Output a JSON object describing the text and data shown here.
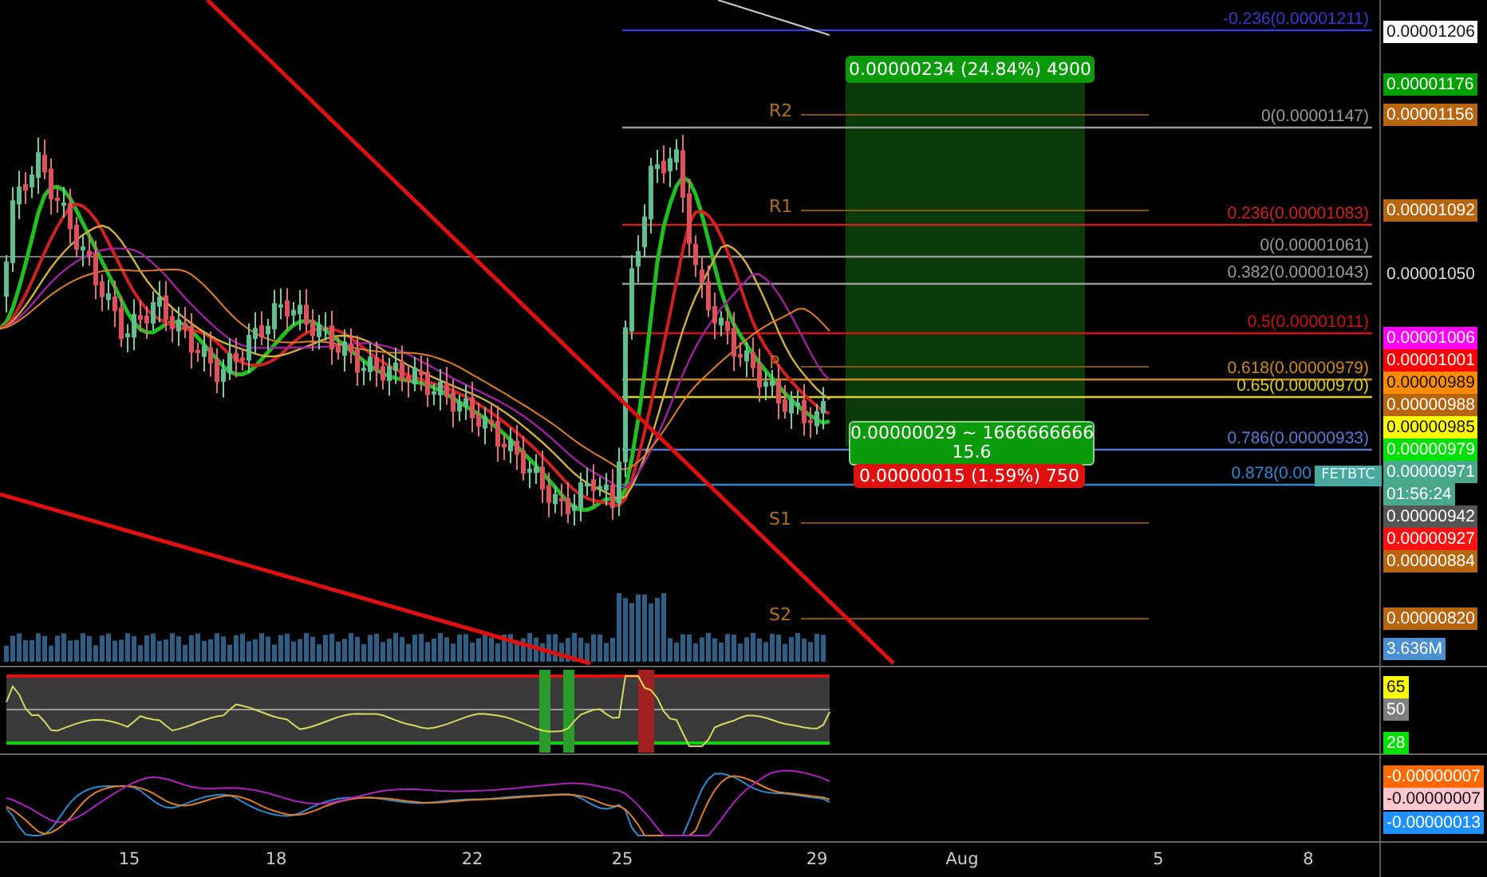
{
  "fib_levels": [
    {
      "label": "-0.236(0.00001211)",
      "color": "#3a3ad0"
    },
    {
      "label": "0(0.00001147)",
      "color": "#9a9a9a"
    },
    {
      "label": "0.236(0.00001083)",
      "color": "#d02020"
    },
    {
      "label": "0(0.00001061)",
      "color": "#9a9a9a"
    },
    {
      "label": "0.382(0.00001043)",
      "color": "#9a9a9a"
    },
    {
      "label": "0.5(0.00001011)",
      "color": "#d01010"
    },
    {
      "label": "0.618(0.00000979)",
      "color": "#d08a10"
    },
    {
      "label": "0.65(0.00000970)",
      "color": "#e0d010"
    },
    {
      "label": "0.786(0.00000933)",
      "color": "#5a7ad0"
    },
    {
      "label": "0.878(0.00",
      "color": "#2a8ad0"
    }
  ],
  "pivots": [
    {
      "label": "R2"
    },
    {
      "label": "R1"
    },
    {
      "label": "P"
    },
    {
      "label": "S1"
    },
    {
      "label": "S2"
    }
  ],
  "position_tool": {
    "target_label": "0.00000234 (24.84%) 4900",
    "ratio_lines": [
      "0.00000029 ~ 1666666666",
      "15.6"
    ],
    "stop_label": "0.00000015 (1.59%) 750"
  },
  "symbol_tag": "FETBTC",
  "price_axis": {
    "labels": [
      {
        "text": "0.00001206",
        "kind": "marker",
        "color": "#ffffff"
      },
      {
        "text": "0.00001176",
        "kind": "marker",
        "color": "#00a000"
      },
      {
        "text": "0.00001156",
        "kind": "marker",
        "color": "#b8650f"
      },
      {
        "text": "0.00001092",
        "kind": "marker",
        "color": "#b8650f"
      },
      {
        "text": "0.00001050",
        "kind": "grid"
      },
      {
        "text": "0.00001006",
        "kind": "marker",
        "color": "#ff00ff"
      },
      {
        "text": "0.00001001",
        "kind": "marker",
        "color": "#ff0000"
      },
      {
        "text": "0.00000989",
        "kind": "marker",
        "color": "#ff8c00"
      },
      {
        "text": "0.00000988",
        "kind": "marker",
        "color": "#b8650f"
      },
      {
        "text": "0.00000985",
        "kind": "marker",
        "color": "#ffff00"
      },
      {
        "text": "0.00000979",
        "kind": "marker",
        "color": "#00e000"
      },
      {
        "text": "0.00000971",
        "kind": "marker",
        "color": "#4aa88a"
      },
      {
        "text": "01:56:24",
        "kind": "marker",
        "color": "#4aa88a"
      },
      {
        "text": "0.00000942",
        "kind": "marker",
        "color": "#555555"
      },
      {
        "text": "0.00000927",
        "kind": "marker",
        "color": "#ff1010"
      },
      {
        "text": "0.00000884",
        "kind": "marker",
        "color": "#b8650f"
      },
      {
        "text": "0.00000820",
        "kind": "marker",
        "color": "#b8650f"
      }
    ]
  },
  "volume_axis": {
    "labels": [
      {
        "text": "3.636M",
        "color": "#4a90d0"
      }
    ]
  },
  "rsi_axis": {
    "labels": [
      {
        "text": "65",
        "color": "#ffff00"
      },
      {
        "text": "50",
        "color": "#808080"
      },
      {
        "text": "28",
        "color": "#00e000"
      }
    ]
  },
  "macd_axis": {
    "labels": [
      {
        "text": "-0.00000007",
        "color": "#ff6a00"
      },
      {
        "text": "-0.00000007",
        "color": "#ffc8d0"
      },
      {
        "text": "-0.00000013",
        "color": "#1e90ff"
      }
    ]
  },
  "time_axis": {
    "labels": [
      "15",
      "18",
      "22",
      "25",
      "29",
      "Aug",
      "5",
      "8"
    ]
  }
}
